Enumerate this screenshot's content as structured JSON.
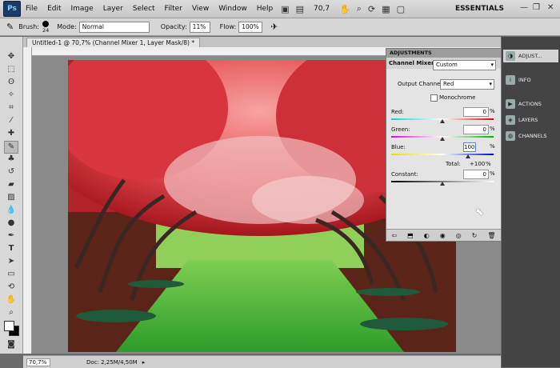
{
  "menubar": {
    "logo": "Ps",
    "items": [
      "File",
      "Edit",
      "Image",
      "Layer",
      "Select",
      "Filter",
      "View",
      "Window",
      "Help"
    ],
    "zoom": "70,7",
    "workspace": "ESSENTIALS"
  },
  "options": {
    "brush_label": "Brush:",
    "brush_size": "24",
    "mode_label": "Mode:",
    "mode_value": "Normal",
    "opacity_label": "Opacity:",
    "opacity_value": "11%",
    "flow_label": "Flow:",
    "flow_value": "100%"
  },
  "document": {
    "tab_title": "Untitled-1 @ 70,7% (Channel Mixer 1, Layer Mask/8) *",
    "status_zoom": "70,7%",
    "status_doc": "Doc: 2,25M/4,50M"
  },
  "adjustments": {
    "panel_title": "ADJUSTMENTS",
    "mixer_label": "Channel Mixer",
    "preset_value": "Custom",
    "output_label": "Output Channel:",
    "output_value": "Red",
    "monochrome_label": "Monochrome",
    "red_label": "Red:",
    "red_value": "0",
    "red_level": 0,
    "green_label": "Green:",
    "green_value": "0",
    "green_level": 0,
    "blue_label": "Blue:",
    "blue_value": "100",
    "blue_level": 100,
    "total_label": "Total:",
    "total_value": "+100",
    "constant_label": "Constant:",
    "constant_value": "0",
    "constant_level": 0,
    "percent": "%"
  },
  "dock": {
    "items": [
      "ADJUST...",
      "INFO",
      "ACTIONS",
      "LAYERS",
      "CHANNELS"
    ]
  }
}
